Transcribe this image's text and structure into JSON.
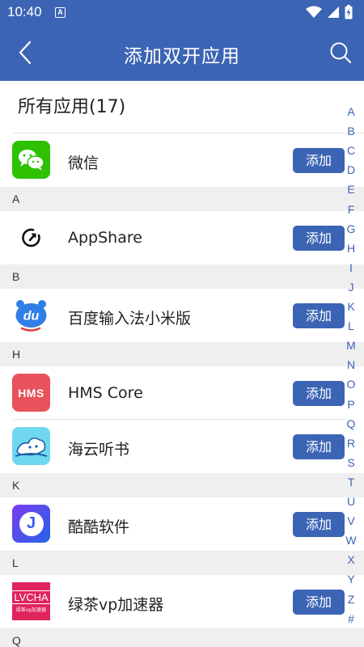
{
  "status_bar": {
    "time": "10:40",
    "notification_letter": "A",
    "icons": [
      "wifi-icon",
      "signal-icon",
      "battery-charging-icon"
    ]
  },
  "app_bar": {
    "title": "添加双开应用",
    "back_icon": "chevron-left-icon",
    "search_icon": "search-icon",
    "color": "#3c64b4"
  },
  "list_header": "所有应用(17)",
  "add_label": "添加",
  "sections": [
    {
      "letter": "",
      "apps": [
        {
          "name": "微信",
          "icon": "wechat-icon"
        }
      ]
    },
    {
      "letter": "A",
      "apps": [
        {
          "name": "AppShare",
          "icon": "appshare-icon"
        }
      ]
    },
    {
      "letter": "B",
      "apps": [
        {
          "name": "百度输入法小米版",
          "icon": "baidu-input-icon",
          "icon_text": "du"
        }
      ]
    },
    {
      "letter": "H",
      "apps": [
        {
          "name": "HMS Core",
          "icon": "hms-core-icon",
          "icon_text": "HMS"
        },
        {
          "name": "海云听书",
          "icon": "haiyun-tingshu-icon"
        }
      ]
    },
    {
      "letter": "K",
      "apps": [
        {
          "name": "酷酷软件",
          "icon": "kuku-software-icon",
          "icon_text": "J"
        }
      ]
    },
    {
      "letter": "L",
      "apps": [
        {
          "name": "绿茶vp加速器",
          "icon": "lvcha-vpn-icon",
          "icon_text": "LVCHA",
          "icon_subtext": "绿茶vp加速器"
        }
      ]
    },
    {
      "letter": "Q",
      "apps": []
    }
  ],
  "index_letters": [
    "A",
    "B",
    "C",
    "D",
    "E",
    "F",
    "G",
    "H",
    "I",
    "J",
    "K",
    "L",
    "M",
    "N",
    "O",
    "P",
    "Q",
    "R",
    "S",
    "T",
    "U",
    "V",
    "W",
    "X",
    "Y",
    "Z",
    "#"
  ]
}
